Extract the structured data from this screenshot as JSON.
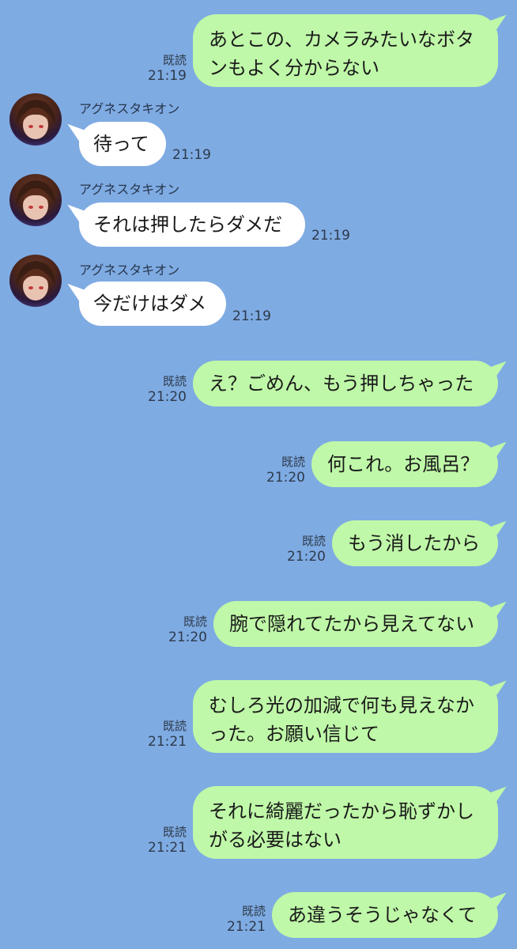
{
  "colors": {
    "background": "#7fabe3",
    "outgoing_bubble": "#bff8a8",
    "incoming_bubble": "#ffffff"
  },
  "sender_name": "アグネスタキオン",
  "messages": [
    {
      "dir": "out",
      "lines": [
        "あとこの、カメラみたいなボタ",
        "ンもよく分からない"
      ],
      "read": "既読",
      "time": "21:19"
    },
    {
      "dir": "in",
      "name": "アグネスタキオン",
      "lines": [
        "待って"
      ],
      "time": "21:19"
    },
    {
      "dir": "in",
      "name": "アグネスタキオン",
      "lines": [
        "それは押したらダメだ"
      ],
      "time": "21:19"
    },
    {
      "dir": "in",
      "name": "アグネスタキオン",
      "lines": [
        "今だけはダメ"
      ],
      "time": "21:19"
    },
    {
      "dir": "out",
      "lines": [
        "え？ごめん、もう押しちゃった"
      ],
      "read": "既読",
      "time": "21:20"
    },
    {
      "dir": "out",
      "lines": [
        "何これ。お風呂？"
      ],
      "read": "既読",
      "time": "21:20"
    },
    {
      "dir": "out",
      "lines": [
        "もう消したから"
      ],
      "read": "既読",
      "time": "21:20"
    },
    {
      "dir": "out",
      "lines": [
        "腕で隠れてたから見えてない"
      ],
      "read": "既読",
      "time": "21:20"
    },
    {
      "dir": "out",
      "lines": [
        "むしろ光の加減で何も見えなか",
        "った。お願い信じて"
      ],
      "read": "既読",
      "time": "21:21"
    },
    {
      "dir": "out",
      "lines": [
        "それに綺麗だったから恥ずかし",
        "がる必要はない"
      ],
      "read": "既読",
      "time": "21:21"
    },
    {
      "dir": "out",
      "lines": [
        "あ違うそうじゃなくて"
      ],
      "read": "既読",
      "time": "21:21"
    }
  ]
}
